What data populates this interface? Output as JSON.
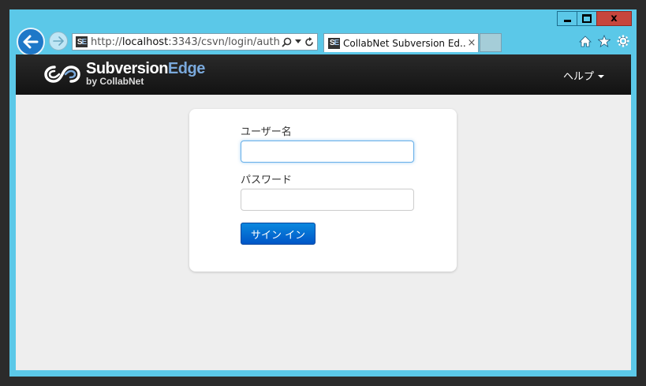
{
  "browser": {
    "url_prefix": "http://",
    "url_host": "localhost",
    "url_rest": ":3343/csvn/login/auth",
    "favicon_text_1": "S",
    "favicon_text_2": "E",
    "tab_title": "CollabNet Subversion Ed...",
    "tab_close": "×",
    "window_close": "x"
  },
  "header": {
    "logo_main": "Subversion",
    "logo_edge": "Edge",
    "logo_sub": "by CollabNet",
    "help_label": "ヘルプ"
  },
  "login": {
    "username_label": "ユーザー名",
    "username_value": "",
    "password_label": "パスワード",
    "password_value": "",
    "signin_label": "サイン イン"
  },
  "colors": {
    "chrome": "#5bc8e8",
    "navbar": "#1a1a1a",
    "signin_button": "#0066cc",
    "edge_text": "#7aa9dc"
  }
}
